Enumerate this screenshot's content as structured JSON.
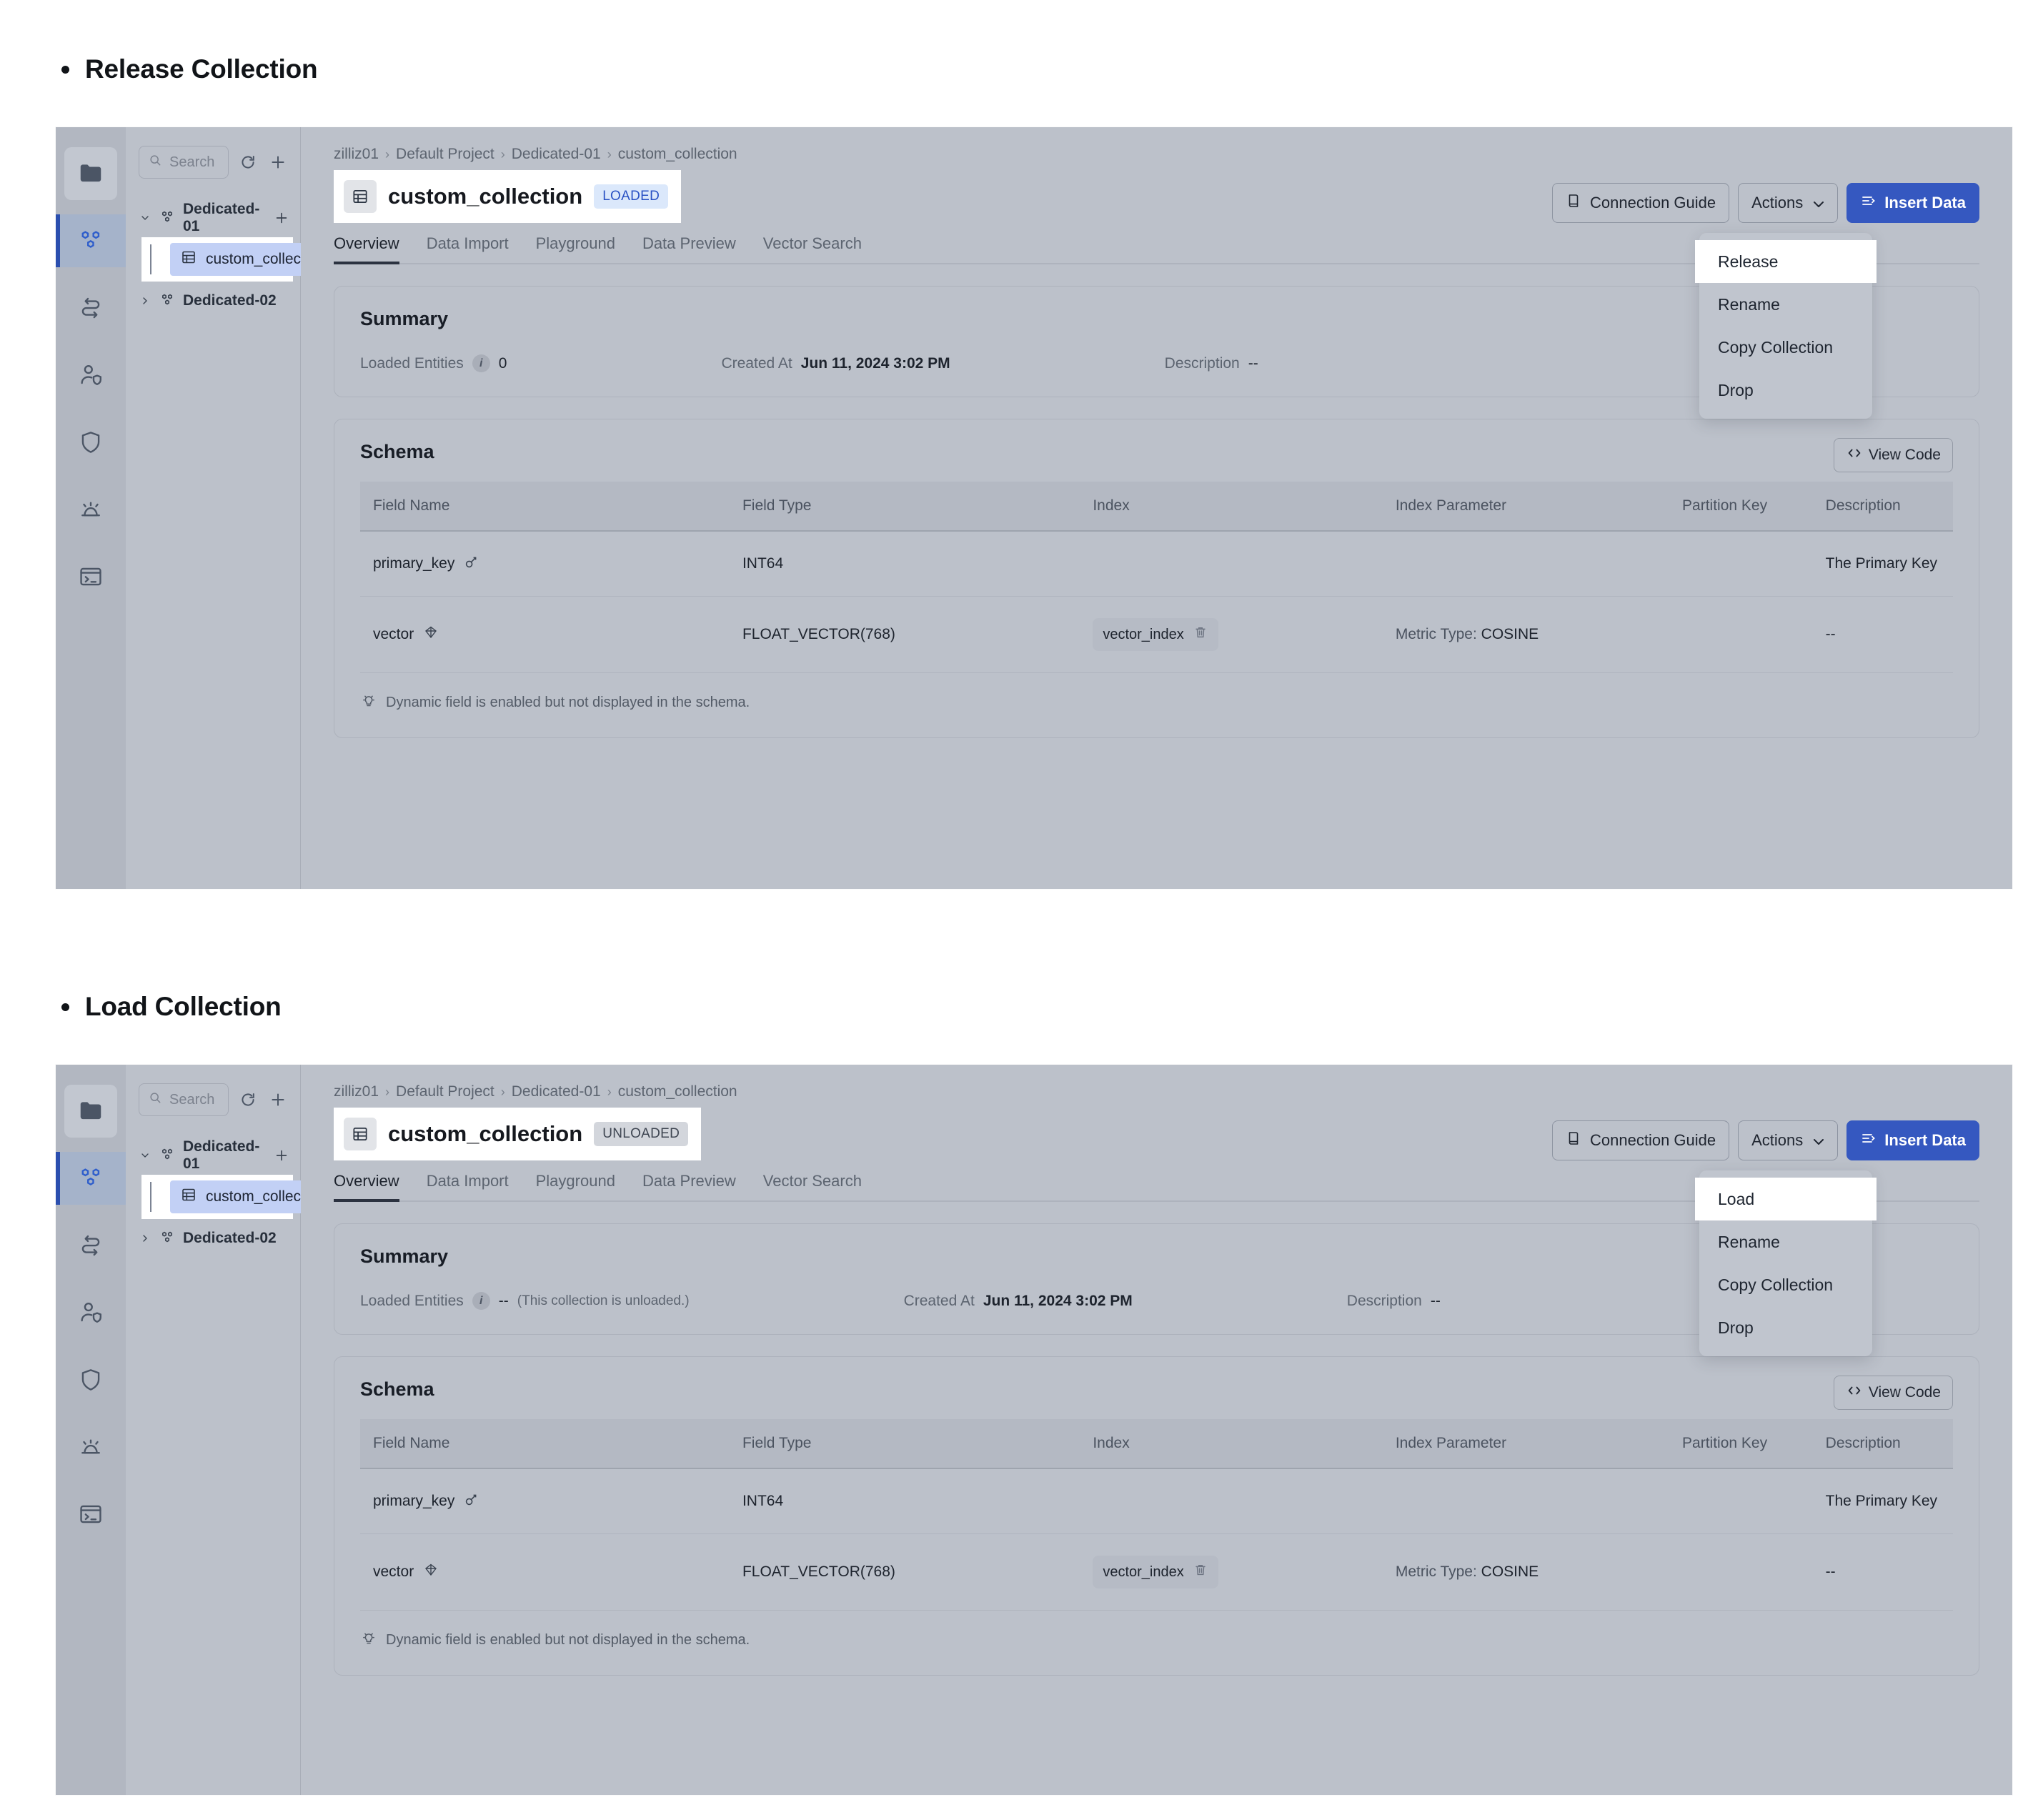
{
  "sections": [
    {
      "heading": "Release Collection",
      "status_badge": "LOADED",
      "loaded_entities_value": "0",
      "loaded_entities_note": "",
      "menu_first_item": "Release"
    },
    {
      "heading": "Load Collection",
      "status_badge": "UNLOADED",
      "loaded_entities_value": "--",
      "loaded_entities_note": "(This collection is unloaded.)",
      "menu_first_item": "Load"
    }
  ],
  "sidebar": {
    "rail_icons": [
      "folder-icon",
      "cluster-icon",
      "migration-icon",
      "user-access-icon",
      "shield-icon",
      "alert-icon",
      "terminal-icon"
    ],
    "search_placeholder": "Search",
    "refresh_label": "refresh-icon",
    "add_label": "plus-icon",
    "tree": [
      {
        "label": "Dedicated-01",
        "expanded": true
      },
      {
        "label": "Dedicated-02",
        "expanded": false
      }
    ],
    "collection_item": "custom_collection"
  },
  "breadcrumb": [
    "zilliz01",
    "Default Project",
    "Dedicated-01",
    "custom_collection"
  ],
  "collection_title": "custom_collection",
  "tabs": [
    {
      "label": "Overview",
      "active": true
    },
    {
      "label": "Data Import",
      "active": false
    },
    {
      "label": "Playground",
      "active": false
    },
    {
      "label": "Data Preview",
      "active": false
    },
    {
      "label": "Vector Search",
      "active": false
    }
  ],
  "toolbar": {
    "connection_guide": "Connection Guide",
    "actions": "Actions",
    "insert_data": "Insert Data"
  },
  "actions_menu": [
    "Rename",
    "Copy Collection",
    "Drop"
  ],
  "summary": {
    "title": "Summary",
    "loaded_entities_label": "Loaded Entities",
    "created_at_label": "Created At",
    "created_at_value": "Jun 11, 2024 3:02 PM",
    "description_label": "Description",
    "description_value": "--"
  },
  "schema": {
    "title": "Schema",
    "view_code": "View Code",
    "columns": [
      "Field Name",
      "Field Type",
      "Index",
      "Index Parameter",
      "Partition Key",
      "Description"
    ],
    "rows": [
      {
        "field_name": "primary_key",
        "field_icon": "key-icon",
        "field_type": "INT64",
        "index": "",
        "index_parameter": "",
        "partition_key": "",
        "description": "The Primary Key"
      },
      {
        "field_name": "vector",
        "field_icon": "vector-icon",
        "field_type": "FLOAT_VECTOR(768)",
        "index": "vector_index",
        "index_parameter_label": "Metric Type:",
        "index_parameter_value": "COSINE",
        "partition_key": "",
        "description": "--"
      }
    ],
    "dynamic_note": "Dynamic field is enabled but not displayed in the schema."
  },
  "colors": {
    "primary": "#3558c0",
    "badge_loaded_bg": "#dbe8fb",
    "badge_loaded_fg": "#2a52c4",
    "selection": "#c2d0f5",
    "panel_bg": "#bcc1ca"
  }
}
